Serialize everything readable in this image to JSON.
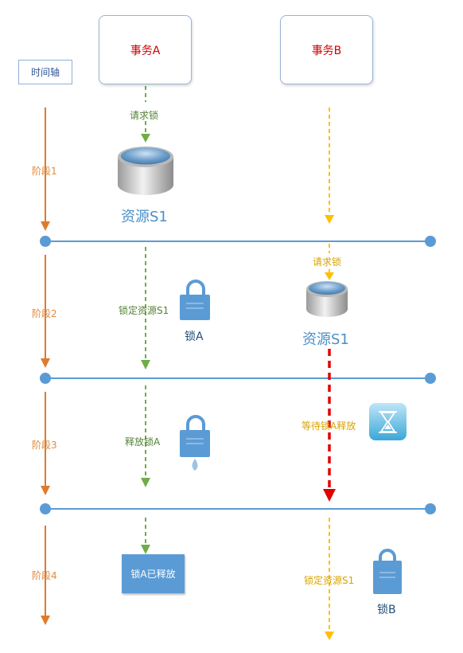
{
  "timeline": {
    "label": "时间轴"
  },
  "transactions": {
    "a": "事务A",
    "b": "事务B"
  },
  "stages": [
    "阶段1",
    "阶段2",
    "阶段3",
    "阶段4"
  ],
  "txA_steps": {
    "request": "请求锁",
    "lock_resource": "锁定资源S1",
    "release": "释放锁A",
    "released": "锁A已释放"
  },
  "txB_steps": {
    "request": "请求锁",
    "waiting": "等待锁A释放",
    "lock_resource": "锁定资源S1"
  },
  "resources": {
    "s1_a": "资源S1",
    "s1_b": "资源S1"
  },
  "locks": {
    "a": "锁A",
    "b": "锁B"
  },
  "colors": {
    "stage_orange": "#e07a2c",
    "green": "#70ad47",
    "amber": "#ffc000",
    "red": "#e00000",
    "blue": "#5b9bd5",
    "tx_text_red": "#cc0000"
  }
}
